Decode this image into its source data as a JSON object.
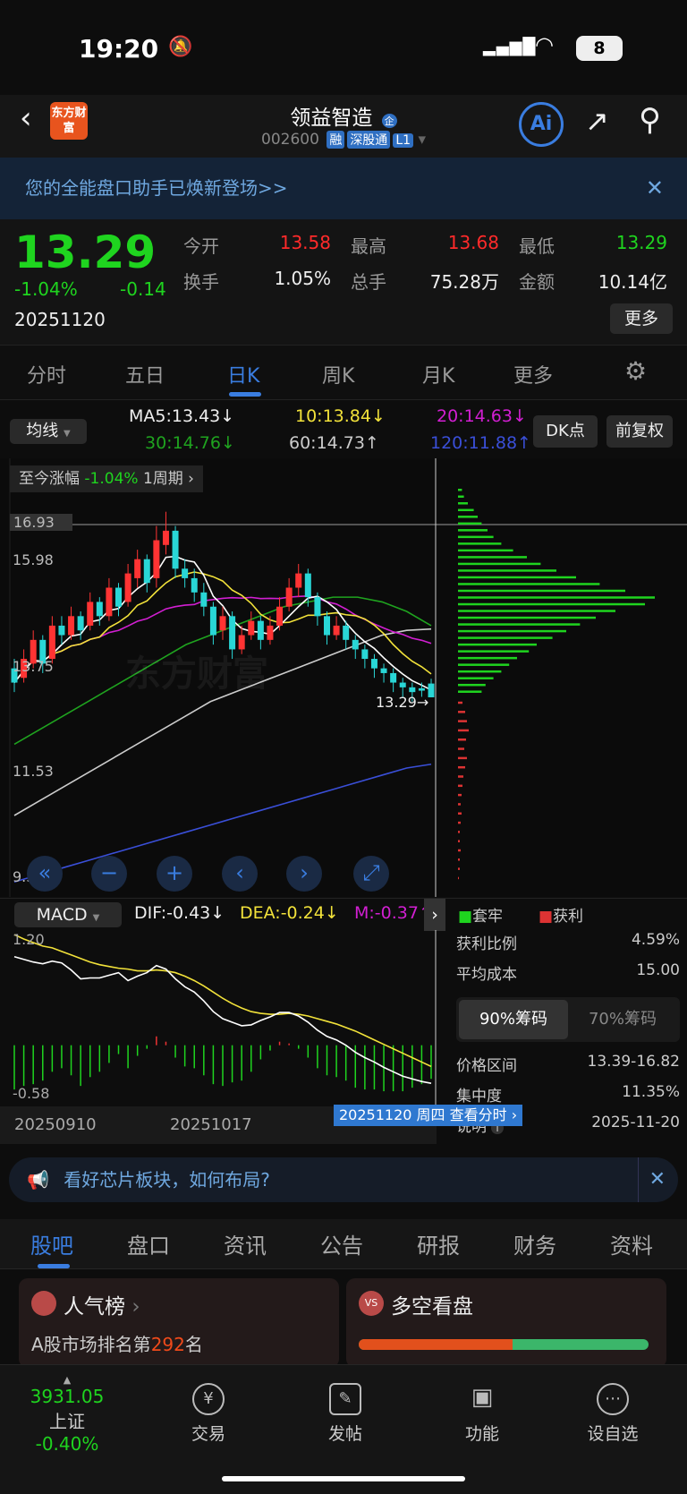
{
  "status": {
    "time": "19:20",
    "battery": "8"
  },
  "header": {
    "logo": "东方财富",
    "title": "领益智造",
    "title_badge": "企",
    "code": "002600",
    "tags": [
      "融",
      "深股通",
      "L1"
    ]
  },
  "banner": {
    "text": "您的全能盘口助手已焕新登场>>"
  },
  "quote": {
    "price": "13.29",
    "pct": "-1.04%",
    "chg": "-0.14",
    "date": "20251120",
    "fields": [
      {
        "label": "今开",
        "value": "13.58",
        "color": "#ff2a2a"
      },
      {
        "label": "最高",
        "value": "13.68",
        "color": "#ff2a2a"
      },
      {
        "label": "最低",
        "value": "13.29",
        "color": "#1fd41f"
      },
      {
        "label": "换手",
        "value": "1.05%",
        "color": "#eeeeee"
      },
      {
        "label": "总手",
        "value": "75.28万",
        "color": "#eeeeee"
      },
      {
        "label": "金额",
        "value": "10.14亿",
        "color": "#eeeeee"
      }
    ],
    "more": "更多"
  },
  "tabs": [
    {
      "label": "分时"
    },
    {
      "label": "五日"
    },
    {
      "label": "日K",
      "active": true
    },
    {
      "label": "周K"
    },
    {
      "label": "月K"
    },
    {
      "label": "更多"
    }
  ],
  "ma": {
    "selector": "均线",
    "ma5": "MA5:13.43↓",
    "ma10": "10:13.84↓",
    "ma20": "20:14.63↓",
    "ma30": "30:14.76↓",
    "ma60": "60:14.73↑",
    "ma120": "120:11.88↑",
    "dk": "DK点",
    "adj": "前复权"
  },
  "chart": {
    "range_label": "至今涨幅",
    "range_value": "-1.04%",
    "period": "1周期",
    "price_ticks": [
      "16.93",
      "15.98",
      "13.75",
      "11.53",
      "9.31"
    ],
    "last_label": "13.29",
    "watermark": "东方财富",
    "colors": {
      "up": "#ff3333",
      "down": "#29d6d6",
      "ma5": "#ffffff",
      "ma10": "#f2e23a",
      "ma20": "#d21fd2",
      "ma30": "#1fa31f",
      "ma60": "#cccccc",
      "ma120": "#3a4fd8"
    }
  },
  "chart_data": {
    "type": "candlestick",
    "ylim": [
      9.31,
      16.93
    ],
    "open": [
      13.9,
      13.7,
      14.0,
      14.5,
      14.1,
      14.8,
      14.6,
      15.0,
      14.8,
      15.3,
      15.0,
      15.6,
      15.3,
      15.8,
      16.2,
      15.8,
      16.5,
      16.8,
      16.0,
      15.8,
      15.5,
      15.2,
      14.7,
      15.0,
      14.3,
      14.6,
      14.9,
      14.5,
      14.8,
      15.2,
      15.6,
      15.9,
      15.4,
      15.0,
      14.6,
      14.8,
      14.5,
      14.3,
      14.1,
      13.9,
      13.8,
      13.6,
      13.5,
      13.48,
      13.58
    ],
    "high": [
      14.1,
      14.3,
      14.7,
      14.6,
      15.0,
      15.0,
      15.2,
      15.1,
      15.5,
      15.4,
      15.8,
      15.7,
      16.1,
      16.4,
      16.3,
      16.9,
      17.2,
      16.9,
      16.2,
      16.0,
      15.7,
      15.3,
      15.2,
      15.1,
      14.8,
      15.1,
      15.0,
      15.0,
      15.4,
      15.8,
      16.1,
      16.0,
      15.5,
      15.1,
      15.0,
      14.9,
      14.6,
      14.4,
      14.2,
      14.0,
      13.9,
      13.7,
      13.6,
      13.6,
      13.68
    ],
    "low": [
      13.4,
      13.6,
      13.9,
      13.8,
      14.0,
      14.4,
      14.5,
      14.5,
      14.7,
      14.8,
      14.9,
      15.0,
      15.2,
      15.6,
      15.5,
      15.6,
      16.3,
      15.8,
      15.6,
      15.3,
      15.0,
      14.4,
      14.5,
      14.1,
      14.2,
      14.5,
      14.3,
      14.4,
      14.7,
      15.1,
      15.4,
      15.2,
      14.8,
      14.4,
      14.5,
      14.3,
      14.1,
      13.9,
      13.7,
      13.6,
      13.4,
      13.3,
      13.2,
      13.3,
      13.29
    ],
    "close": [
      13.6,
      14.1,
      14.5,
      14.0,
      14.8,
      14.6,
      15.0,
      14.7,
      15.3,
      15.0,
      15.6,
      15.2,
      15.9,
      16.2,
      15.7,
      16.6,
      16.8,
      16.0,
      15.8,
      15.5,
      15.2,
      14.6,
      15.0,
      14.3,
      14.6,
      14.9,
      14.5,
      14.8,
      15.2,
      15.6,
      15.9,
      15.4,
      15.0,
      14.6,
      14.8,
      14.5,
      14.3,
      14.1,
      13.9,
      13.8,
      13.6,
      13.5,
      13.4,
      13.43,
      13.29
    ],
    "ma30": [
      12.3,
      12.6,
      12.9,
      13.2,
      13.5,
      13.8,
      14.1,
      14.4,
      14.6,
      14.8,
      15.0,
      15.2,
      15.3,
      15.4,
      15.4,
      15.3,
      15.1,
      14.8
    ],
    "ma60": [
      10.8,
      11.1,
      11.4,
      11.7,
      12.0,
      12.3,
      12.6,
      12.9,
      13.2,
      13.4,
      13.6,
      13.8,
      14.0,
      14.2,
      14.4,
      14.6,
      14.7,
      14.73
    ],
    "ma120": [
      9.4,
      9.55,
      9.7,
      9.85,
      10.0,
      10.15,
      10.3,
      10.45,
      10.6,
      10.75,
      10.9,
      11.05,
      11.2,
      11.35,
      11.5,
      11.65,
      11.8,
      11.88
    ]
  },
  "tools": [
    "rewind-icon",
    "zoom-out-icon",
    "zoom-in-icon",
    "prev-icon",
    "next-icon",
    "fullscreen-icon"
  ],
  "chips": {
    "legend_trapped": "套牢",
    "legend_profit": "获利",
    "profit_ratio_label": "获利比例",
    "profit_ratio": "4.59%",
    "avg_cost_label": "平均成本",
    "avg_cost": "15.00",
    "tab90": "90%筹码",
    "tab70": "70%筹码",
    "range_label": "价格区间",
    "range": "13.39-16.82",
    "conc_label": "集中度",
    "conc": "11.35%",
    "note_label": "说明",
    "note_date": "2025-11-20",
    "profile_trapped": [
      2,
      3,
      5,
      8,
      10,
      12,
      15,
      18,
      22,
      28,
      35,
      42,
      50,
      60,
      72,
      85,
      100,
      95,
      80,
      70,
      62,
      55,
      48,
      40,
      36,
      30,
      26,
      22,
      18,
      14,
      12
    ],
    "profile_profit": [
      5,
      8,
      10,
      12,
      9,
      7,
      10,
      8,
      6,
      5,
      4,
      3,
      4,
      3,
      2,
      2,
      3,
      2,
      2,
      1
    ]
  },
  "macd": {
    "selector": "MACD",
    "dif": "DIF:-0.43↓",
    "dea": "DEA:-0.24↓",
    "m": "M:-0.37↑",
    "top": "1.20",
    "bottom": "-0.58",
    "dif_values": [
      1.0,
      0.97,
      0.94,
      0.92,
      0.95,
      0.93,
      0.85,
      0.75,
      0.76,
      0.76,
      0.79,
      0.82,
      0.73,
      0.78,
      0.82,
      0.9,
      0.86,
      0.75,
      0.66,
      0.6,
      0.5,
      0.38,
      0.3,
      0.26,
      0.22,
      0.23,
      0.28,
      0.32,
      0.37,
      0.37,
      0.33,
      0.26,
      0.17,
      0.1,
      0.06,
      0.0,
      -0.08,
      -0.14,
      -0.19,
      -0.25,
      -0.3,
      -0.35,
      -0.38,
      -0.41,
      -0.43
    ],
    "dea_values": [
      1.25,
      1.2,
      1.16,
      1.12,
      1.1,
      1.06,
      1.02,
      0.98,
      0.94,
      0.91,
      0.89,
      0.87,
      0.86,
      0.84,
      0.84,
      0.85,
      0.84,
      0.82,
      0.78,
      0.73,
      0.67,
      0.6,
      0.53,
      0.47,
      0.42,
      0.38,
      0.36,
      0.35,
      0.35,
      0.36,
      0.35,
      0.33,
      0.3,
      0.27,
      0.24,
      0.2,
      0.16,
      0.11,
      0.06,
      0.01,
      -0.04,
      -0.09,
      -0.14,
      -0.19,
      -0.24
    ]
  },
  "dates": {
    "d1": "20250910",
    "d2": "20251017",
    "tooltip": "20251120 周四 查看分时"
  },
  "notice": {
    "text": "看好芯片板块，如何布局?"
  },
  "bottom_tabs": [
    {
      "label": "股吧",
      "active": true
    },
    {
      "label": "盘口"
    },
    {
      "label": "资讯"
    },
    {
      "label": "公告"
    },
    {
      "label": "研报"
    },
    {
      "label": "财务"
    },
    {
      "label": "资料"
    }
  ],
  "cards": {
    "popular_title": "人气榜",
    "popular_prefix": "A股市场排名第",
    "popular_rank": "292",
    "popular_suffix": "名",
    "vs_title": "多空看盘",
    "bull_ratio": 0.53
  },
  "nav": {
    "index_value": "3931.05",
    "index_name": "上证",
    "index_pct": "-0.40%",
    "items": [
      {
        "label": "交易"
      },
      {
        "label": "发帖"
      },
      {
        "label": "功能"
      },
      {
        "label": "设自选"
      }
    ]
  }
}
